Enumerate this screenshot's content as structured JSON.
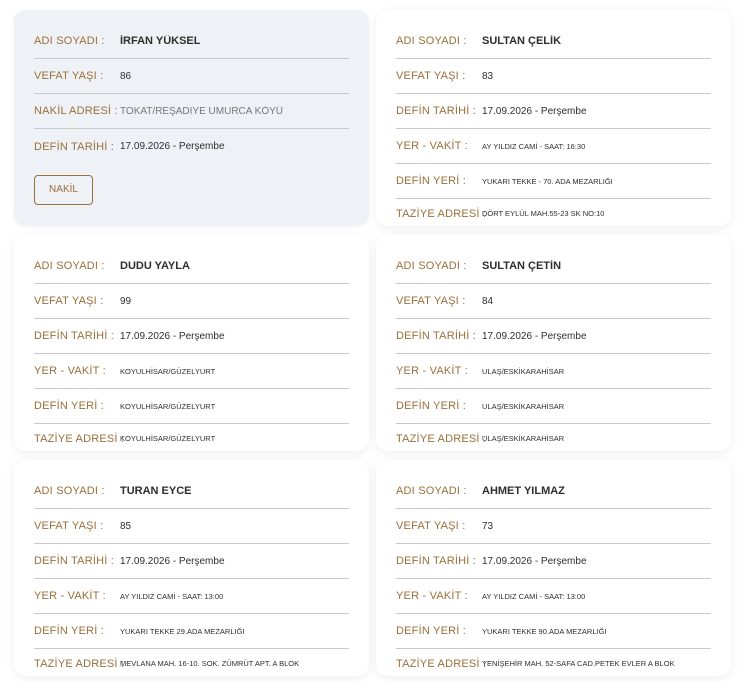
{
  "labels": {
    "name": "ADI SOYADI :",
    "age": "VEFAT YAŞI :",
    "transfer": "NAKİL ADRESİ :",
    "burial_date": "DEFİN TARİHİ :",
    "place_time": "YER - VAKİT :",
    "burial_place": "DEFİN YERİ :",
    "condolence": "TAZİYE ADRESİ :"
  },
  "cards": [
    {
      "name": "İRFAN YÜKSEL",
      "age": "86",
      "transfer": "TOKAT/REŞADİYE UMURCA KÖYÜ",
      "burial_date": "17.09.2026 - Perşembe",
      "button": "NAKİL"
    },
    {
      "name": "SULTAN ÇELİK",
      "age": "83",
      "burial_date": "17.09.2026 - Perşembe",
      "place_time": "AY YILDIZ CAMİ - SAAT: 16:30",
      "burial_place": "YUKARI TEKKE - 70. ADA MEZARLIĞI",
      "condolence": "DÖRT EYLÜL MAH.55-23 SK NO:10"
    },
    {
      "name": "DUDU YAYLA",
      "age": "99",
      "burial_date": "17.09.2026 - Perşembe",
      "place_time": "KOYULHİSAR/GÜZELYURT",
      "burial_place": "KOYULHİSAR/GÜZELYURT",
      "condolence": "KOYULHİSAR/GÜZELYURT"
    },
    {
      "name": "SULTAN ÇETİN",
      "age": "84",
      "burial_date": "17.09.2026 - Perşembe",
      "place_time": "ULAŞ/ESKİKARAHİSAR",
      "burial_place": "ULAŞ/ESKİKARAHİSAR",
      "condolence": "ULAŞ/ESKİKARAHİSAR"
    },
    {
      "name": "TURAN EYCE",
      "age": "85",
      "burial_date": "17.09.2026 - Perşembe",
      "place_time": "AY YILDIZ CAMİ - SAAT: 13:00",
      "burial_place": "YUKARI TEKKE 29.ADA MEZARLIĞI",
      "condolence": "MEVLANA MAH. 16-10. SOK. ZÜMRÜT APT. A BLOK"
    },
    {
      "name": "AHMET YILMAZ",
      "age": "73",
      "burial_date": "17.09.2026 - Perşembe",
      "place_time": "AY YILDIZ CAMİ - SAAT: 13:00",
      "burial_place": "YUKARI TEKKE 90.ADA MEZARLIĞI",
      "condolence": "YENİŞEHİR MAH. 52-SAFA CAD.PETEK EVLER A BLOK"
    }
  ]
}
